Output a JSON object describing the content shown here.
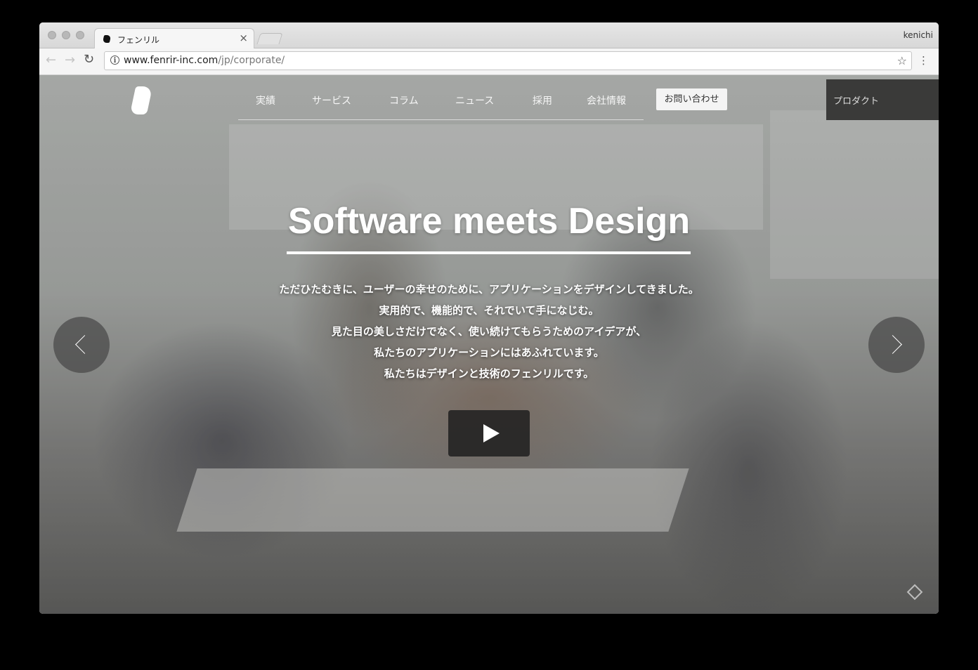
{
  "browser": {
    "tab_title": "フェンリル",
    "tab_close": "×",
    "profile_name": "kenichi",
    "url_host": "www.fenrir-inc.com",
    "url_path": "/jp/corporate/",
    "back_glyph": "←",
    "forward_glyph": "→",
    "reload_glyph": "↻",
    "star_glyph": "☆",
    "menu_glyph": "⋮",
    "info_glyph": "i"
  },
  "nav": {
    "items": [
      "実績",
      "サービス",
      "コラム",
      "ニュース",
      "採用",
      "会社情報"
    ],
    "contact": "お問い合わせ",
    "product": "プロダクト"
  },
  "hero": {
    "headline": "Software meets Design",
    "lines": [
      "ただひたむきに、ユーザーの幸せのために、アプリケーションをデザインしてきました。",
      "実用的で、機能的で、それでいて手になじむ。",
      "見た目の美しさだけでなく、使い続けてもらうためのアイデアが、",
      "私たちのアプリケーションにはあふれています。",
      "私たちはデザインと技術のフェンリルです。"
    ]
  },
  "icons": {
    "logo": "fenrir-logo-icon",
    "prev": "chevron-left-icon",
    "next": "chevron-right-icon",
    "play": "play-icon"
  }
}
